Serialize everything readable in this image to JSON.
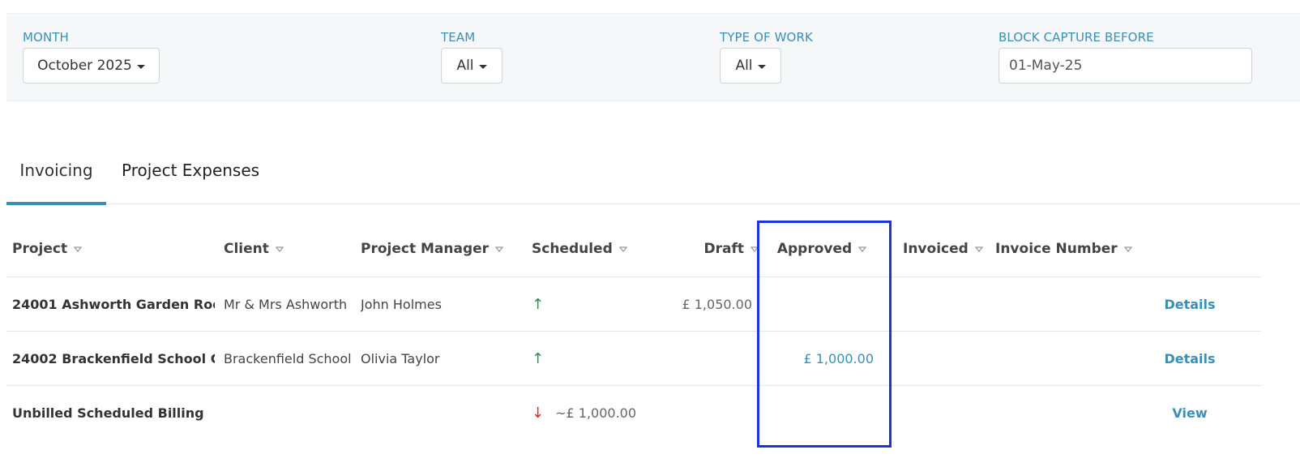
{
  "filters": {
    "month": {
      "label": "MONTH",
      "value": "October 2025"
    },
    "team": {
      "label": "TEAM",
      "value": "All"
    },
    "type_of_work": {
      "label": "TYPE OF WORK",
      "value": "All"
    },
    "block_capture": {
      "label": "BLOCK CAPTURE BEFORE",
      "value": "01-May-25"
    }
  },
  "tabs": [
    {
      "label": "Invoicing",
      "active": true
    },
    {
      "label": "Project Expenses",
      "active": false
    }
  ],
  "table": {
    "headers": {
      "project": "Project",
      "client": "Client",
      "project_manager": "Project Manager",
      "scheduled": "Scheduled",
      "draft": "Draft",
      "approved": "Approved",
      "invoiced": "Invoiced",
      "invoice_number": "Invoice Number"
    },
    "rows": [
      {
        "project": "24001 Ashworth Garden Roo...",
        "client": "Mr & Mrs Ashworth",
        "project_manager": "John Holmes",
        "scheduled_arrow": "up",
        "scheduled_amount": "",
        "draft": "£ 1,050.00",
        "approved": "",
        "invoiced": "",
        "invoice_number": "",
        "action": "Details"
      },
      {
        "project": "24002 Brackenfield School G...",
        "client": "Brackenfield School",
        "project_manager": "Olivia Taylor",
        "scheduled_arrow": "up",
        "scheduled_amount": "",
        "draft": "",
        "approved": "£ 1,000.00",
        "invoiced": "",
        "invoice_number": "",
        "action": "Details"
      },
      {
        "project": "Unbilled Scheduled Billing",
        "client": "",
        "project_manager": "",
        "scheduled_arrow": "down",
        "scheduled_amount": "~£ 1,000.00",
        "draft": "",
        "approved": "",
        "invoiced": "",
        "invoice_number": "",
        "action": "View"
      }
    ]
  },
  "icons": {
    "caret": "caret-down-icon",
    "sort": "sort-triangle-icon",
    "arrow_up": "arrow-up-icon",
    "arrow_down": "arrow-down-icon"
  },
  "colors": {
    "accent": "#3a8fb7",
    "highlight": "#1a35e0",
    "arrow_up": "#2e8b57",
    "arrow_down": "#cc3333"
  }
}
